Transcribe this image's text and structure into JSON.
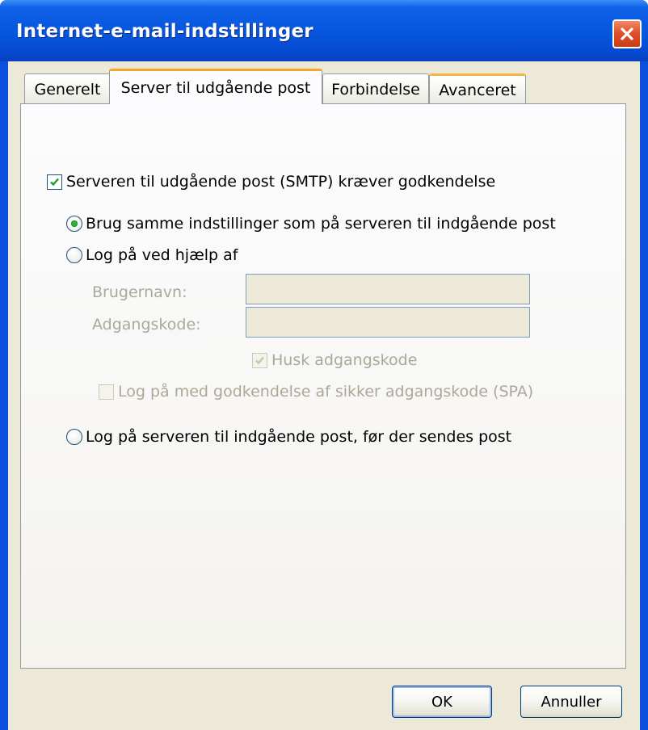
{
  "window": {
    "title": "Internet-e-mail-indstillinger"
  },
  "tabs": [
    {
      "label": "Generelt"
    },
    {
      "label": "Server til udgående post"
    },
    {
      "label": "Forbindelse"
    },
    {
      "label": "Avanceret"
    }
  ],
  "active_tab": "Server til udgående post",
  "outgoing": {
    "smtp_auth_label": "Serveren til udgående post (SMTP) kræver godkendelse",
    "smtp_auth_checked": true,
    "same_settings_label": "Brug samme indstillinger som på serveren til indgående post",
    "same_settings_selected": true,
    "log_on_using_label": "Log på ved hjælp af",
    "log_on_using_selected": false,
    "username_label": "Brugernavn:",
    "username_value": "",
    "password_label": "Adgangskode:",
    "password_value": "",
    "remember_password_label": "Husk adgangskode",
    "remember_password_checked": true,
    "spa_label": "Log på med godkendelse af sikker adgangskode (SPA)",
    "spa_checked": false,
    "log_on_incoming_label": "Log på serveren til indgående post, før der sendes post",
    "log_on_incoming_selected": false
  },
  "buttons": {
    "ok": "OK",
    "cancel": "Annuller"
  },
  "colors": {
    "title_bar": "#0655dd",
    "dialog_bg": "#ece9d8",
    "tab_highlight": "#f5a623",
    "close_button": "#e0502a",
    "radio_selected": "#2bb33a",
    "disabled_text": "#aca899"
  },
  "icons": {
    "close": "close-icon",
    "checkmark": "checkmark-icon"
  }
}
